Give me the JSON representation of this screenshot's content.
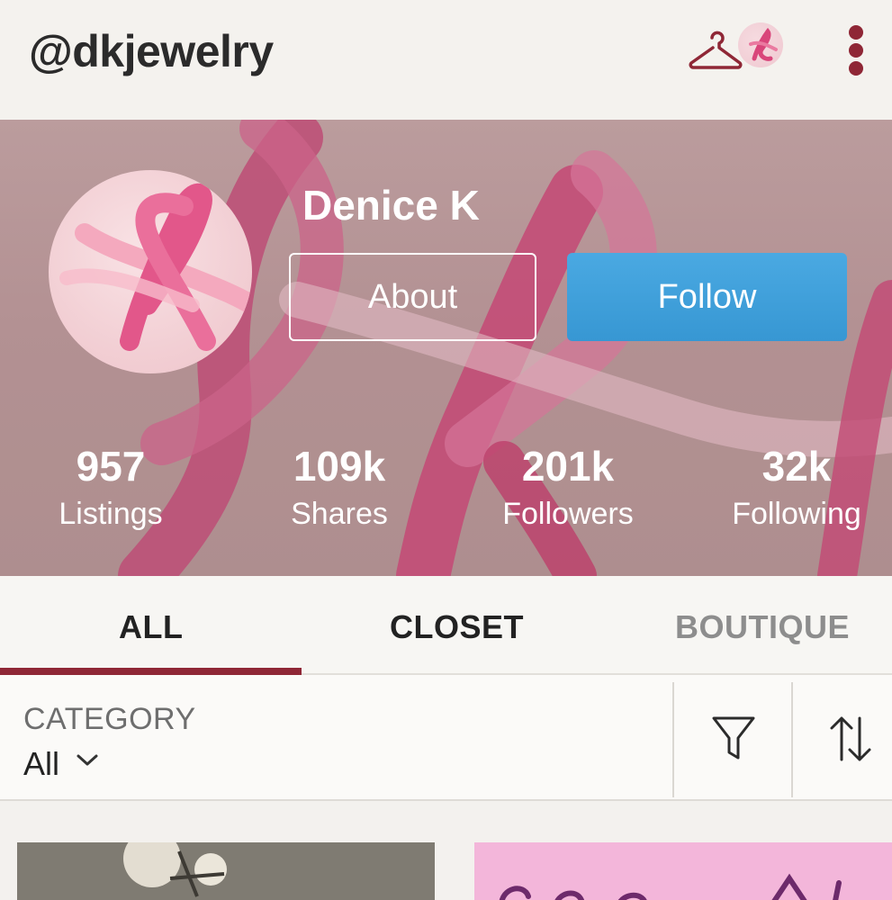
{
  "header": {
    "handle": "@dkjewelry",
    "closet_icon": "hanger-icon",
    "menu_icon": "more-vertical-icon"
  },
  "profile": {
    "name": "Denice K",
    "about_label": "About",
    "follow_label": "Follow",
    "stats": [
      {
        "value": "957",
        "label": "Listings"
      },
      {
        "value": "109k",
        "label": "Shares"
      },
      {
        "value": "201k",
        "label": "Followers"
      },
      {
        "value": "32k",
        "label": "Following"
      }
    ]
  },
  "tabs": [
    {
      "label": "ALL",
      "active": true
    },
    {
      "label": "CLOSET",
      "active": false
    },
    {
      "label": "BOUTIQUE",
      "active": false
    }
  ],
  "filter": {
    "category_label": "CATEGORY",
    "category_value": "All",
    "filter_icon": "filter-icon",
    "sort_icon": "sort-icon"
  },
  "colors": {
    "accent": "#8f2736",
    "follow_button": "#3a9ad6",
    "ribbon_pink": "#d9457a"
  }
}
